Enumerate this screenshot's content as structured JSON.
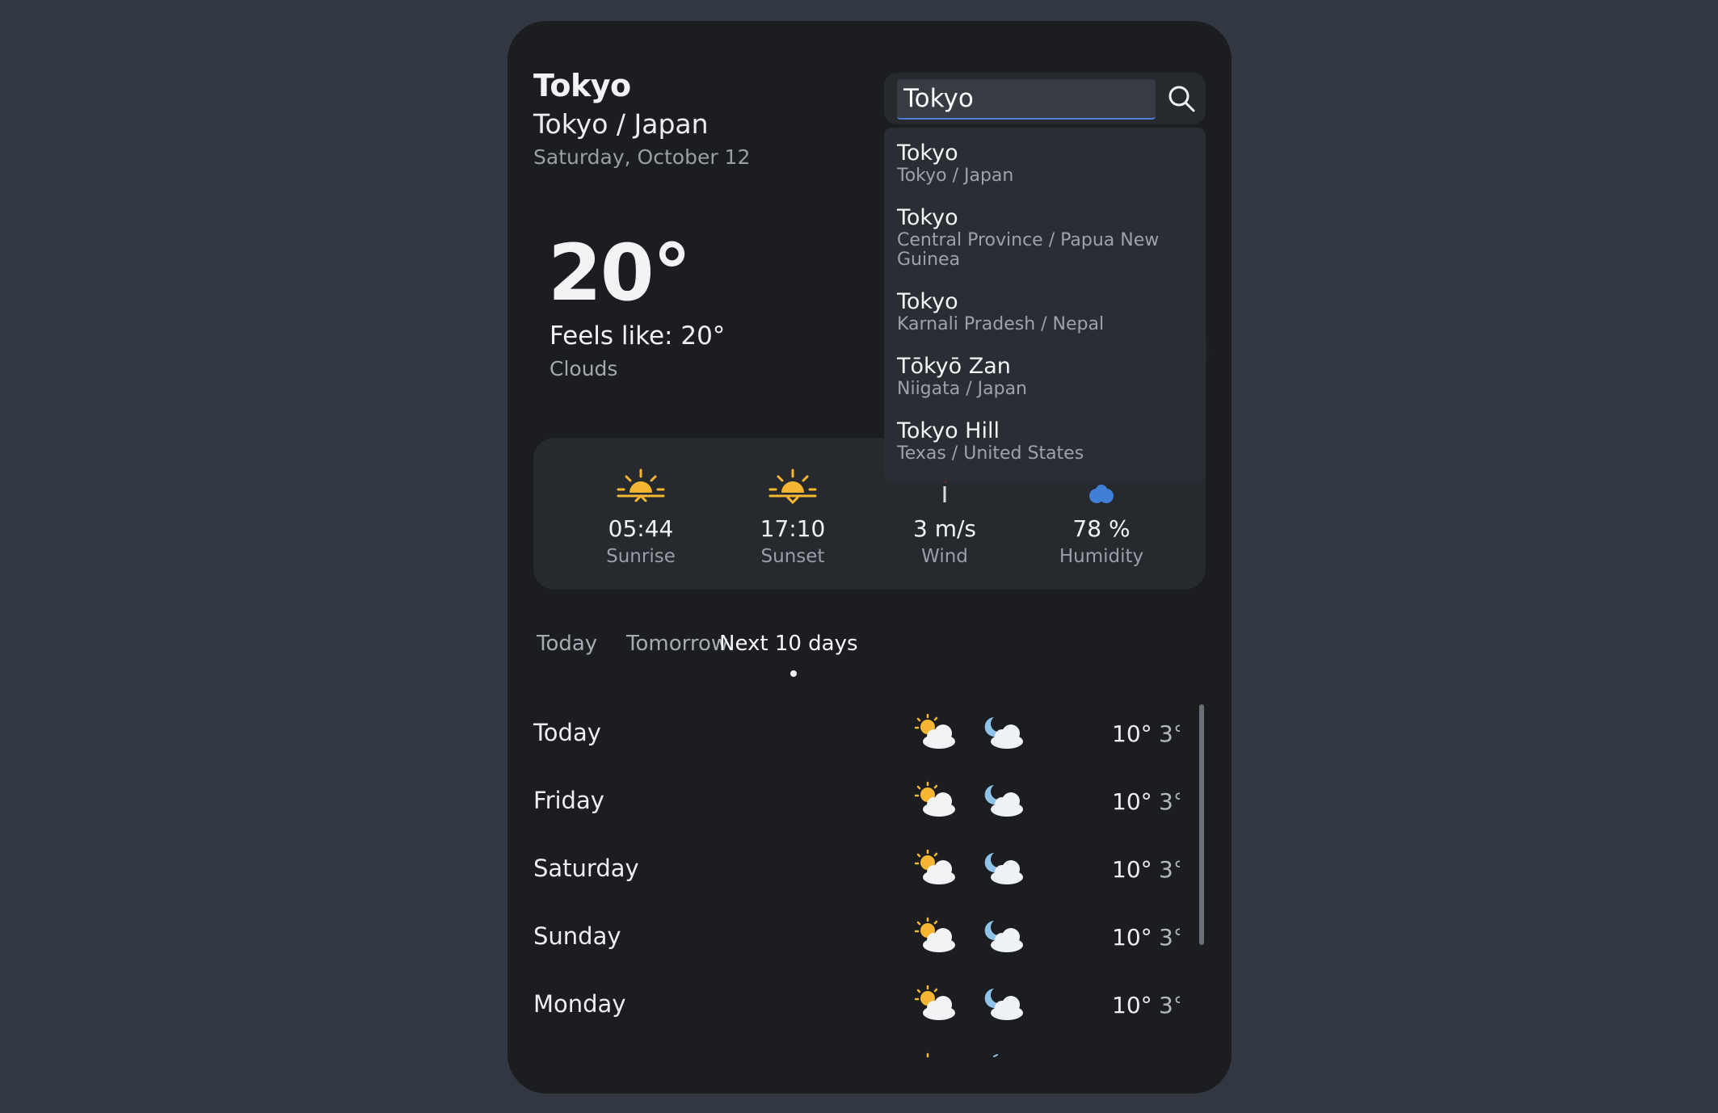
{
  "location": {
    "city": "Tokyo",
    "region": "Tokyo / Japan",
    "date": "Saturday, October 12"
  },
  "current": {
    "temperature": "20°",
    "feels_like": "Feels like: 20°",
    "condition": "Clouds",
    "icon": "cloud-icon"
  },
  "stats": [
    {
      "value": "05:44",
      "label": "Sunrise",
      "icon": "sunrise-icon"
    },
    {
      "value": "17:10",
      "label": "Sunset",
      "icon": "sunset-icon"
    },
    {
      "value": "3 m/s",
      "label": "Wind",
      "icon": "wind-icon"
    },
    {
      "value": "78 %",
      "label": "Humidity",
      "icon": "humidity-icon"
    }
  ],
  "search": {
    "value": "Tokyo",
    "icon": "search-icon"
  },
  "suggestions": [
    {
      "name": "Tokyo",
      "region": "Tokyo / Japan"
    },
    {
      "name": "Tokyo",
      "region": "Central Province / Papua New Guinea"
    },
    {
      "name": "Tokyo",
      "region": "Karnali Pradesh / Nepal"
    },
    {
      "name": "Tōkyō Zan",
      "region": "Niigata / Japan"
    },
    {
      "name": "Tokyo Hill",
      "region": "Texas / United States"
    }
  ],
  "tabs": [
    {
      "label": "Today",
      "active": false
    },
    {
      "label": "Tomorrow",
      "active": false
    },
    {
      "label": "Next 10 days",
      "active": true
    }
  ],
  "forecast": [
    {
      "day": "Today",
      "high": "10°",
      "low": "3°",
      "day_icon": "partly-cloudy-day-icon",
      "night_icon": "partly-cloudy-night-icon"
    },
    {
      "day": "Friday",
      "high": "10°",
      "low": "3°",
      "day_icon": "partly-cloudy-day-icon",
      "night_icon": "partly-cloudy-night-icon"
    },
    {
      "day": "Saturday",
      "high": "10°",
      "low": "3°",
      "day_icon": "partly-cloudy-day-icon",
      "night_icon": "partly-cloudy-night-icon"
    },
    {
      "day": "Sunday",
      "high": "10°",
      "low": "3°",
      "day_icon": "partly-cloudy-day-icon",
      "night_icon": "partly-cloudy-night-icon"
    },
    {
      "day": "Monday",
      "high": "10°",
      "low": "3°",
      "day_icon": "partly-cloudy-day-icon",
      "night_icon": "partly-cloudy-night-icon"
    }
  ],
  "colors": {
    "page_background": "#323841",
    "card_background": "#1c1d20",
    "panel_background": "#26292e",
    "sun": "#f5b731",
    "humidity": "#3f7fd6",
    "muted_text": "#9a9ea6"
  }
}
